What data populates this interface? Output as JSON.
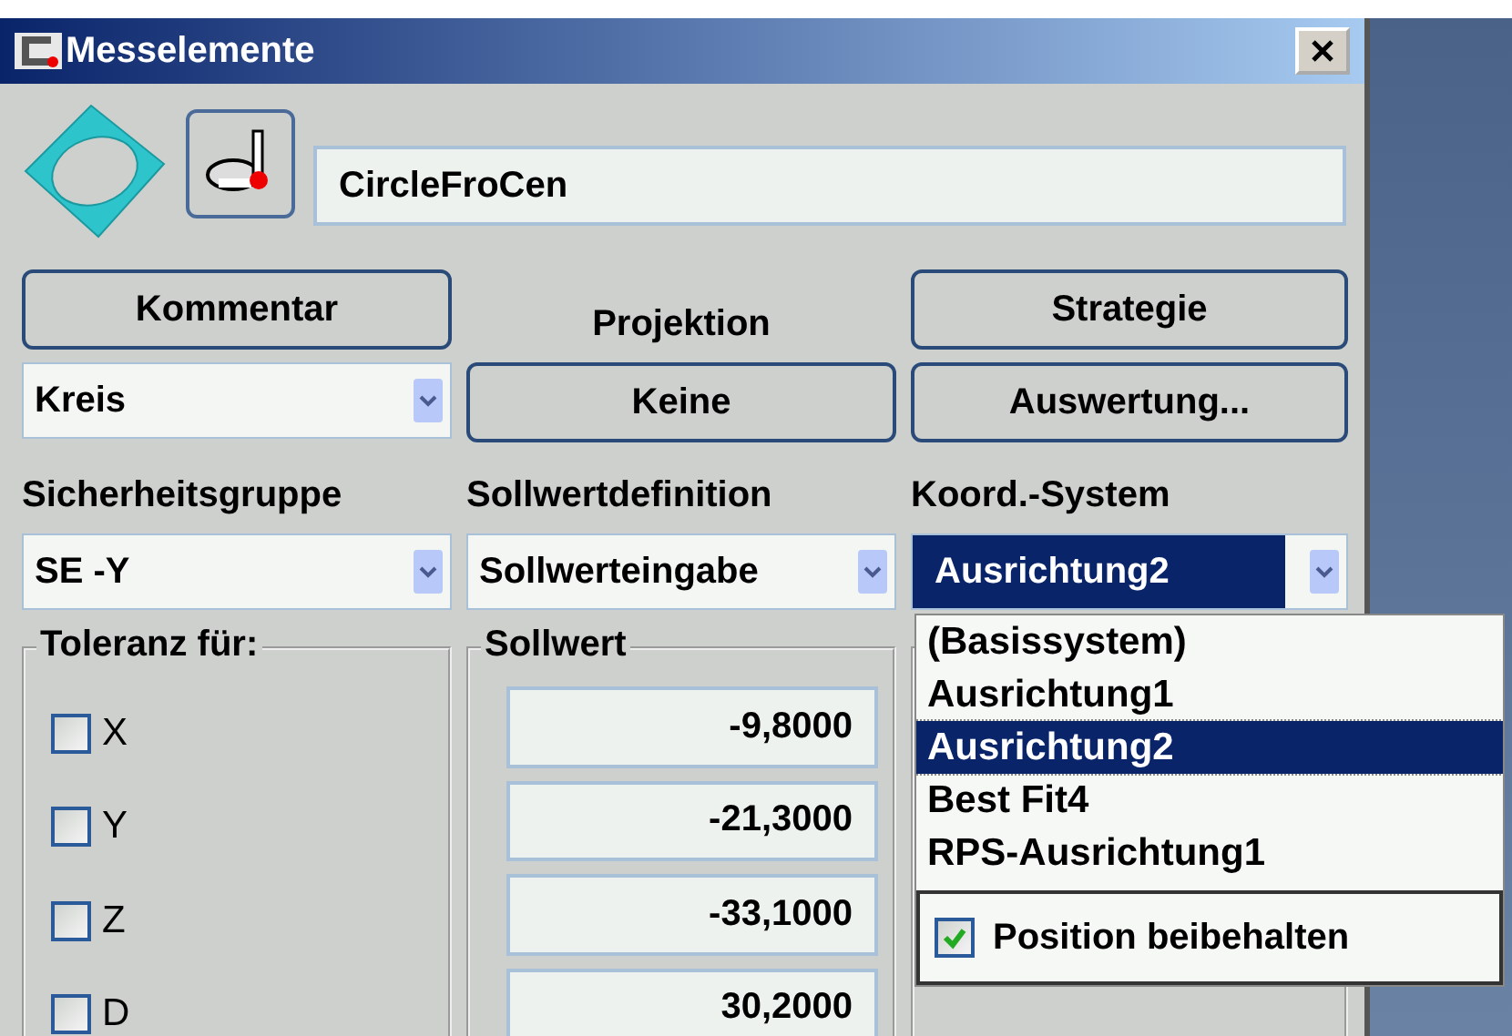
{
  "window": {
    "title": "Messelemente"
  },
  "element_name": {
    "value": "CircleFroCen"
  },
  "row1": [
    {
      "kind": "button",
      "label": "Kommentar"
    },
    {
      "kind": "label",
      "label": "Projektion"
    },
    {
      "kind": "button",
      "label": "Strategie"
    }
  ],
  "row2": [
    {
      "kind": "combo",
      "value": "Kreis"
    },
    {
      "kind": "button",
      "label": "Keine"
    },
    {
      "kind": "button",
      "label": "Auswertung..."
    }
  ],
  "field_labels": [
    "Sicherheitsgruppe",
    "Sollwertdefinition",
    "Koord.-System"
  ],
  "combos": [
    {
      "value": "SE -Y",
      "focused": false
    },
    {
      "value": "Sollwerteingabe",
      "focused": false
    },
    {
      "value": "Ausrichtung2",
      "focused": true
    }
  ],
  "tolerance": {
    "title": "Toleranz für:",
    "items": [
      {
        "label": "X",
        "checked": false
      },
      {
        "label": "Y",
        "checked": false
      },
      {
        "label": "Z",
        "checked": false
      },
      {
        "label": "D",
        "checked": false
      }
    ]
  },
  "nominal": {
    "title": "Sollwert",
    "values": [
      "-9,8000",
      "-21,3000",
      "-33,1000",
      "30,2000"
    ]
  },
  "dropdown": {
    "expanded": true,
    "options": [
      {
        "label": "(Basissystem)",
        "selected": false
      },
      {
        "label": "Ausrichtung1",
        "selected": false
      },
      {
        "label": "Ausrichtung2",
        "selected": true
      },
      {
        "label": "Best Fit4",
        "selected": false
      },
      {
        "label": "RPS-Ausrichtung1",
        "selected": false
      }
    ],
    "keep_position": {
      "label": "Position beibehalten",
      "checked": true
    }
  }
}
